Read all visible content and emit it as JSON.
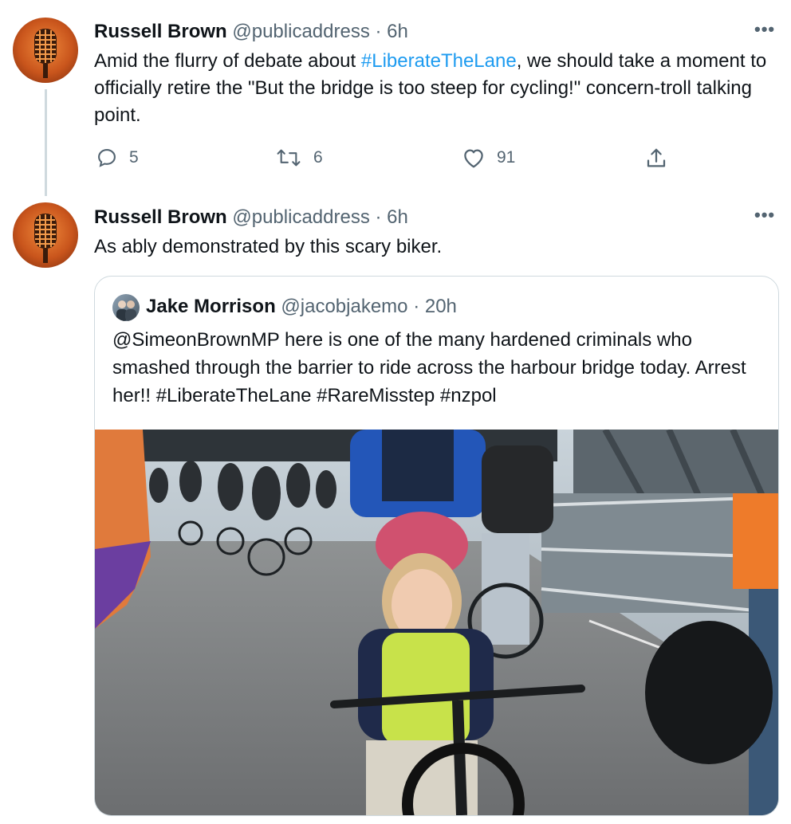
{
  "tweets": [
    {
      "author_name": "Russell Brown",
      "author_handle": "@publicaddress",
      "separator": "·",
      "time": "6h",
      "text_parts": [
        "Amid the flurry of debate about ",
        "#LiberateTheLane",
        ", we should take a moment to officially retire the \"But the bridge is too steep for cycling!\" concern-troll talking point."
      ],
      "replies": "5",
      "retweets": "6",
      "likes": "91"
    },
    {
      "author_name": "Russell Brown",
      "author_handle": "@publicaddress",
      "separator": "·",
      "time": "6h",
      "text": "As ably demonstrated by this scary biker."
    }
  ],
  "quoted_tweet": {
    "author_name": "Jake Morrison",
    "author_handle": "@jacobjakemo",
    "separator": "·",
    "time": "20h",
    "text": "@SimeonBrownMP here is one of the many hardened criminals who smashed through the barrier to ride across the harbour bridge today. Arrest her!! #LiberateTheLane #RareMisstep #nzpol"
  },
  "icons": {
    "more": "more-options-icon",
    "reply": "reply-icon",
    "retweet": "retweet-icon",
    "like": "like-icon",
    "share": "share-icon"
  },
  "colors": {
    "link": "#1d9bf0",
    "secondary_text": "#536471",
    "border": "#cfd9de"
  }
}
